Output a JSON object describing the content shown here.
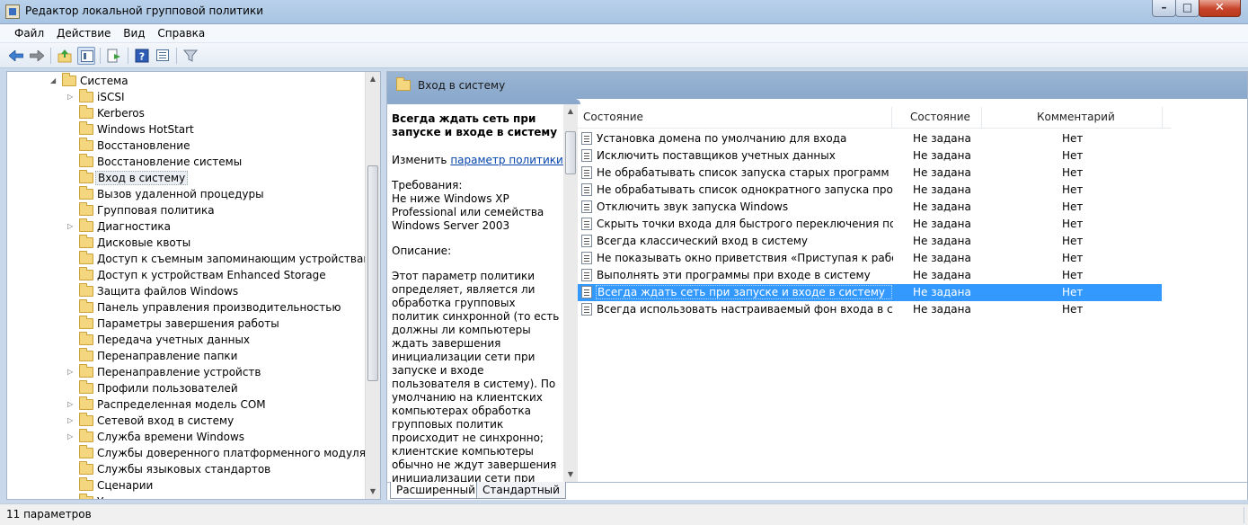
{
  "window": {
    "title": "Редактор локальной групповой политики",
    "controls": {
      "minimize": "–",
      "maximize": "□",
      "close": "✕"
    }
  },
  "menu": [
    "Файл",
    "Действие",
    "Вид",
    "Справка"
  ],
  "toolbar": {
    "buttons": [
      "back-icon",
      "forward-icon",
      "up-folder-icon",
      "show-hide-tree-icon",
      "export-list-icon",
      "help-icon",
      "properties-icon",
      "filter-icon"
    ]
  },
  "tree": {
    "root": "Система",
    "items": [
      {
        "label": "iSCSI",
        "expandable": true
      },
      {
        "label": "Kerberos",
        "expandable": false
      },
      {
        "label": "Windows HotStart",
        "expandable": false
      },
      {
        "label": "Восстановление",
        "expandable": false
      },
      {
        "label": "Восстановление системы",
        "expandable": false
      },
      {
        "label": "Вход в систему",
        "expandable": false,
        "selected": true
      },
      {
        "label": "Вызов удаленной процедуры",
        "expandable": false
      },
      {
        "label": "Групповая политика",
        "expandable": false
      },
      {
        "label": "Диагностика",
        "expandable": true
      },
      {
        "label": "Дисковые квоты",
        "expandable": false
      },
      {
        "label": "Доступ к съемным запоминающим устройствам",
        "expandable": false
      },
      {
        "label": "Доступ к устройствам Enhanced Storage",
        "expandable": false
      },
      {
        "label": "Защита файлов Windows",
        "expandable": false
      },
      {
        "label": "Панель управления производительностью",
        "expandable": false
      },
      {
        "label": "Параметры завершения работы",
        "expandable": false
      },
      {
        "label": "Передача учетных данных",
        "expandable": false
      },
      {
        "label": "Перенаправление папки",
        "expandable": false
      },
      {
        "label": "Перенаправление устройств",
        "expandable": true
      },
      {
        "label": "Профили пользователей",
        "expandable": false
      },
      {
        "label": "Распределенная модель COM",
        "expandable": true
      },
      {
        "label": "Сетевой вход в систему",
        "expandable": true
      },
      {
        "label": "Служба времени Windows",
        "expandable": true
      },
      {
        "label": "Службы доверенного платформенного модуля",
        "expandable": false
      },
      {
        "label": "Службы языковых стандартов",
        "expandable": false
      },
      {
        "label": "Сценарии",
        "expandable": false
      },
      {
        "label": "Управление",
        "expandable": false
      }
    ]
  },
  "details": {
    "header": "Вход в систему",
    "description": {
      "title": "Всегда ждать сеть при запуске и входе в систему",
      "edit_prefix": "Изменить ",
      "edit_link": "параметр политики",
      "requirements_label": "Требования:",
      "requirements_text": "Не ниже Windows XP Professional или семейства Windows Server 2003",
      "description_label": "Описание:",
      "description_text": "Этот параметр политики определяет, является ли обработка групповых политик синхронной (то есть должны ли компьютеры ждать завершения инициализации сети при запуске и входе пользователя в систему). По умолчанию на клиентских компьютерах обработка групповых политик происходит не синхронно; клиентские компьютеры обычно не ждут завершения инициализации сети при запуске и входе пользователя в систему. Существующие"
    },
    "columns": [
      "Состояние",
      "Состояние",
      "Комментарий"
    ],
    "rows": [
      {
        "name": "Установка домена по умолчанию для входа",
        "state": "Не задана",
        "comment": "Нет"
      },
      {
        "name": "Исключить поставщиков учетных данных",
        "state": "Не задана",
        "comment": "Нет"
      },
      {
        "name": "Не обрабатывать список запуска старых программ",
        "state": "Не задана",
        "comment": "Нет"
      },
      {
        "name": "Не обрабатывать список однократного запуска программ",
        "state": "Не задана",
        "comment": "Нет"
      },
      {
        "name": "Отключить звук запуска Windows",
        "state": "Не задана",
        "comment": "Нет"
      },
      {
        "name": "Скрыть точки входа для быстрого переключения пользо...",
        "state": "Не задана",
        "comment": "Нет"
      },
      {
        "name": "Всегда классический вход в систему",
        "state": "Не задана",
        "comment": "Нет"
      },
      {
        "name": "Не показывать окно приветствия «Приступая к работе» п...",
        "state": "Не задана",
        "comment": "Нет"
      },
      {
        "name": "Выполнять эти программы при входе в систему",
        "state": "Не задана",
        "comment": "Нет"
      },
      {
        "name": "Всегда ждать сеть при запуске и входе в систему",
        "state": "Не задана",
        "comment": "Нет",
        "selected": true
      },
      {
        "name": "Всегда использовать настраиваемый фон входа в систему",
        "state": "Не задана",
        "comment": "Нет"
      }
    ],
    "tabs": [
      "Расширенный",
      "Стандартный"
    ]
  },
  "status": "11 параметров"
}
